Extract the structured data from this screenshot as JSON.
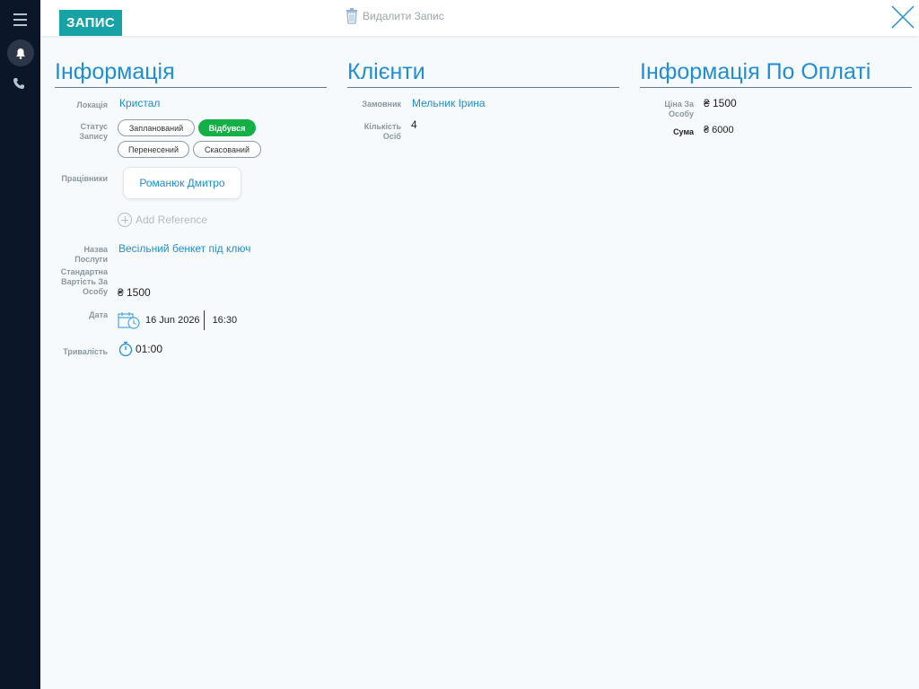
{
  "app": {
    "title": "ЗАПИС",
    "delete_label": "Видалити Запис"
  },
  "sections": {
    "info": "Інформація",
    "clients": "Клієнти",
    "payment": "Інформація По Оплаті"
  },
  "info": {
    "location_label": "Локація",
    "location_value": "Кристал",
    "status_label": "Статус Запису",
    "status_options": [
      "Запланований",
      "Відбувся",
      "Перенесений",
      "Скасований"
    ],
    "status_selected": "Відбувся",
    "workers_label": "Працівники",
    "worker": "Романюк Дмитро",
    "add_reference": "Add Reference",
    "service_label": "Назва Послуги",
    "service_value": "Весільний бенкет під ключ",
    "std_price_label": "Стандартна Вартість За Особу",
    "std_price_value": "₴ 1500",
    "date_label": "Дата",
    "date_value": "16 Jun 2026",
    "time_value": "16:30",
    "duration_label": "Тривалість",
    "duration_value": "01:00"
  },
  "clients": {
    "customer_label": "Замовник",
    "customer_value": "Мельник Ірина",
    "count_label": "Кількість Осіб",
    "count_value": "4"
  },
  "payment": {
    "price_label": "Ціна За Особу",
    "price_value": "₴ 1500",
    "sum_label": "Сума",
    "sum_value": "₴ 6000"
  },
  "colors": {
    "accent": "#1e8ed8",
    "title_button": "#17a2a6",
    "active_status": "#13b047",
    "sidebar": "#0b1628"
  },
  "icons": [
    "menu-icon",
    "bell-icon",
    "phone-icon",
    "trash-icon",
    "close-icon",
    "plus-circle-icon",
    "calendar-icon",
    "stopwatch-icon"
  ]
}
